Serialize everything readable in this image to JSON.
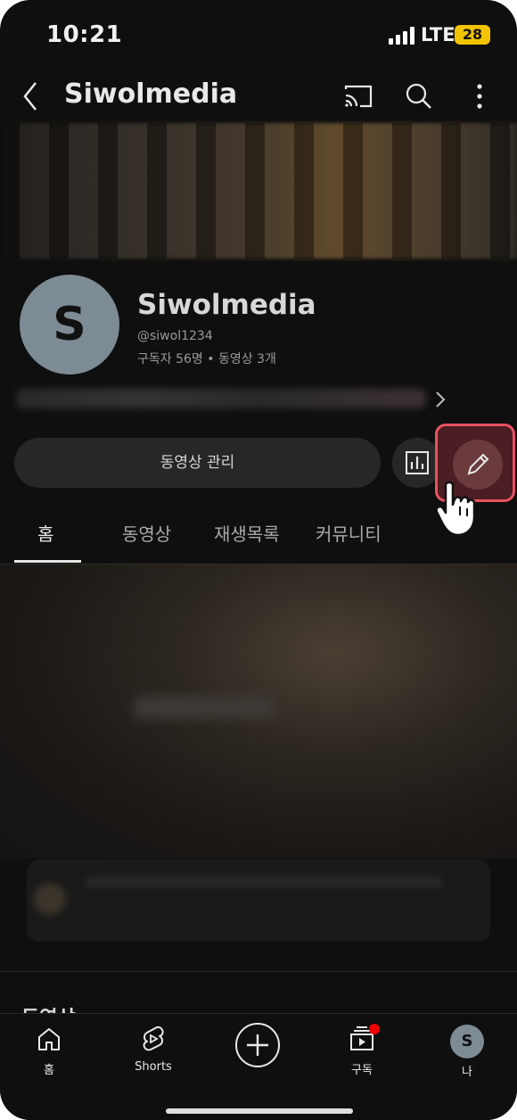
{
  "status_bar": {
    "time": "10:21",
    "network": "LTE",
    "battery": "28"
  },
  "app_bar": {
    "title": "Siwolmedia",
    "icons": [
      "back-arrow-icon",
      "cast-icon",
      "search-icon",
      "more-vert-icon"
    ]
  },
  "channel": {
    "avatar_letter": "S",
    "name": "Siwolmedia",
    "handle": "@siwol1234",
    "stats": "구독자 56명 • 동영상 3개"
  },
  "actions": {
    "manage_videos": "동영상 관리",
    "analytics_icon": "analytics-icon",
    "edit_icon": "pencil-icon"
  },
  "tabs": [
    "홈",
    "동영상",
    "재생목록",
    "커뮤니티"
  ],
  "section_title_peek": "동영상",
  "bottom_nav": {
    "home": "홈",
    "shorts": "Shorts",
    "create_icon": "plus-icon",
    "subscriptions": "구독",
    "me_avatar": "S",
    "me": "나"
  },
  "colors": {
    "background": "#0f0f0f",
    "highlight": "#e9515f",
    "notification": "#ee0000"
  }
}
